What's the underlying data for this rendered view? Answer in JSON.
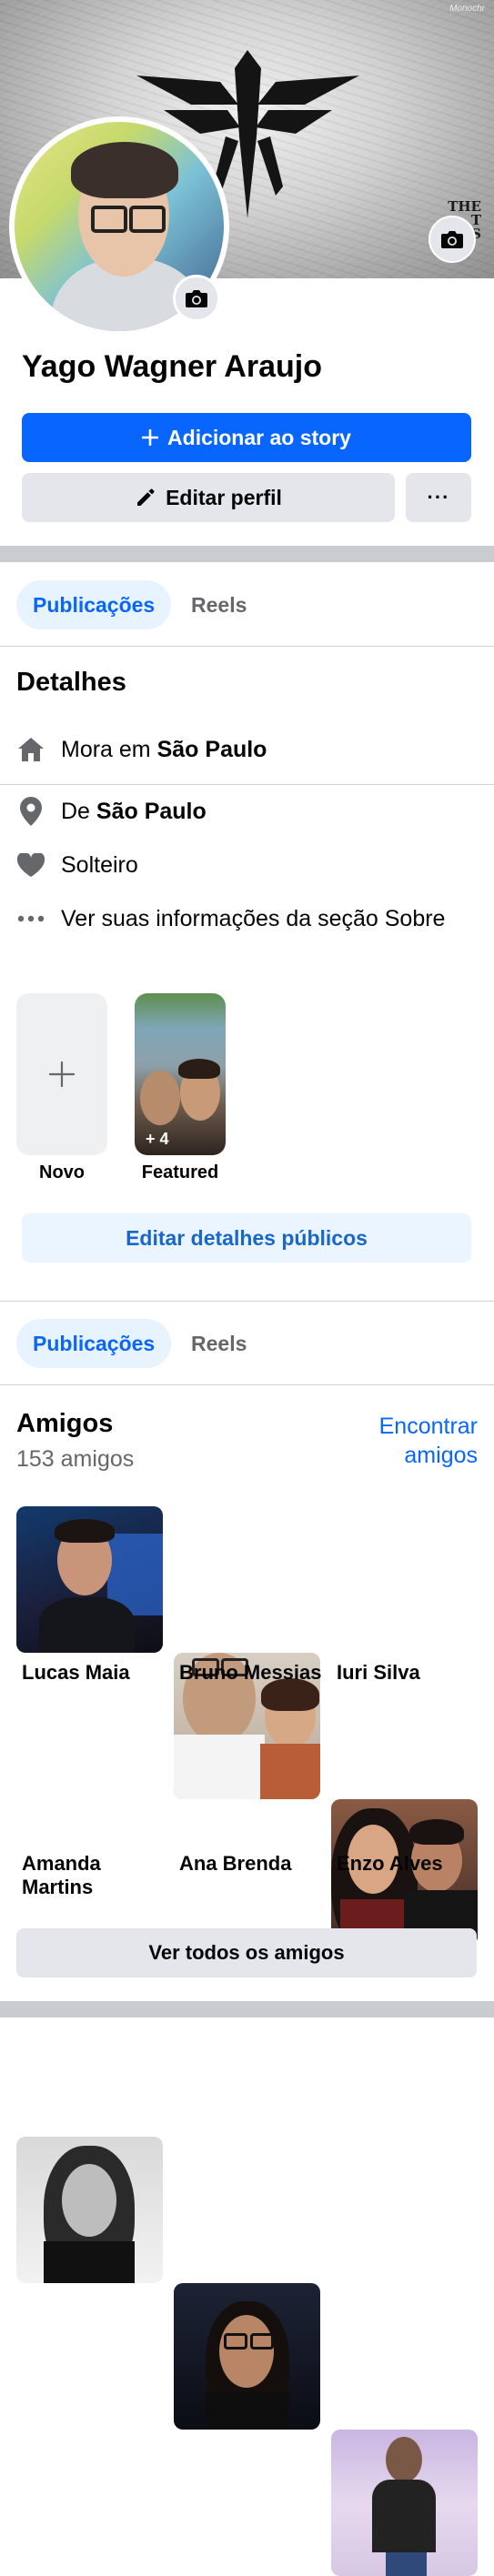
{
  "cover": {
    "watermark_text": "Monochr",
    "game_logo_lines": [
      "THE",
      "T",
      "US"
    ],
    "camera_icon": "camera-icon"
  },
  "profile": {
    "name": "Yago Wagner Araujo",
    "avatar_camera_icon": "camera-icon"
  },
  "actions": {
    "add_story_label": "Adicionar ao story",
    "edit_profile_label": "Editar perfil",
    "more_label": "···"
  },
  "tabs_top": [
    {
      "label": "Publicações",
      "active": true
    },
    {
      "label": "Reels",
      "active": false
    }
  ],
  "details": {
    "title": "Detalhes",
    "lives_prefix": "Mora em ",
    "lives_city": "São Paulo",
    "from_prefix": "De ",
    "from_city": "São Paulo",
    "relationship": "Solteiro",
    "about_link": "Ver suas informações da seção Sobre"
  },
  "featured": {
    "new_label": "Novo",
    "collection_label": "Featured",
    "collection_count": "+ 4"
  },
  "edit_public_details_label": "Editar detalhes públicos",
  "tabs_bottom": [
    {
      "label": "Publicações",
      "active": true
    },
    {
      "label": "Reels",
      "active": false
    }
  ],
  "friends": {
    "title": "Amigos",
    "count_text": "153 amigos",
    "find_friends_line1": "Encontrar",
    "find_friends_line2": "amigos",
    "items": [
      {
        "name": "Lucas Maia"
      },
      {
        "name": "Bruno Messias"
      },
      {
        "name": "Iuri Silva"
      },
      {
        "name_line1": "Amanda",
        "name_line2": "Martins"
      },
      {
        "name": "Ana Brenda"
      },
      {
        "name": "Enzo Alves"
      }
    ],
    "see_all_label": "Ver todos os amigos"
  },
  "colors": {
    "primary": "#0866ff",
    "link": "#1a67c9",
    "secondary_bg": "#e4e6eb",
    "separator": "#c9ccd1"
  }
}
